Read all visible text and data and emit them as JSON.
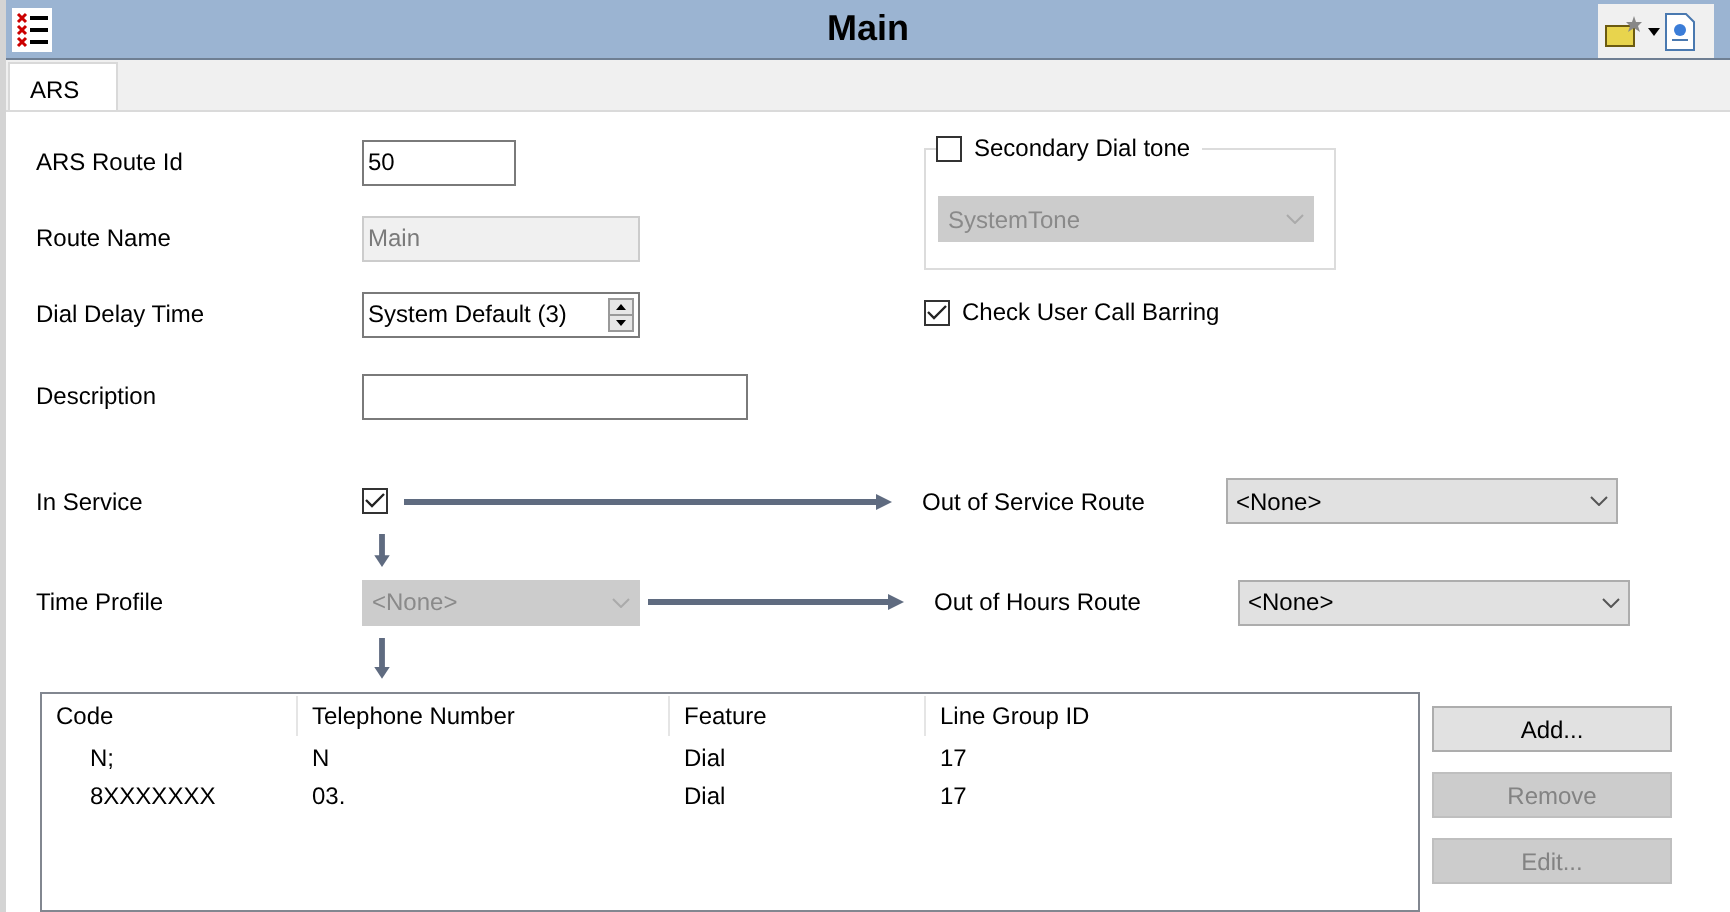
{
  "window": {
    "title": "Main"
  },
  "tabs": [
    {
      "label": "ARS",
      "selected": true
    }
  ],
  "form": [
    {
      "kind": "text",
      "label": "ARS Route Id",
      "value": "50",
      "disabled": false
    },
    {
      "kind": "text",
      "label": "Route Name",
      "value": "Main",
      "disabled": true
    },
    {
      "kind": "spin",
      "label": "Dial Delay Time",
      "value": "System Default (3)",
      "disabled": false
    },
    {
      "kind": "text",
      "label": "Description",
      "disabled": false
    }
  ],
  "secondary_dial_tone": {
    "label": "Secondary Dial tone",
    "checked": false,
    "select": {
      "value": "SystemTone",
      "disabled": true
    }
  },
  "check_user_call_barring": {
    "label": "Check User Call Barring",
    "checked": true
  },
  "in_service": {
    "label": "In Service",
    "checked": true
  },
  "out_of_service_route": {
    "label": "Out of Service Route",
    "value": "<None>",
    "disabled": false
  },
  "time_profile": {
    "label": "Time Profile",
    "value": "<None>",
    "disabled": true
  },
  "out_of_hours_route": {
    "label": "Out of Hours Route",
    "value": "<None>",
    "disabled": false
  },
  "table": {
    "columns": [
      "Code",
      "Telephone Number",
      "Feature",
      "Line Group ID"
    ],
    "rows": [
      [
        "N;",
        "N",
        "Dial",
        "17"
      ],
      [
        "8XXXXXXX",
        "03.",
        "Dial",
        "17"
      ]
    ]
  },
  "buttons": [
    {
      "label": "Add...",
      "disabled": false
    },
    {
      "label": "Remove",
      "disabled": true
    },
    {
      "label": "Edit...",
      "disabled": true
    }
  ]
}
